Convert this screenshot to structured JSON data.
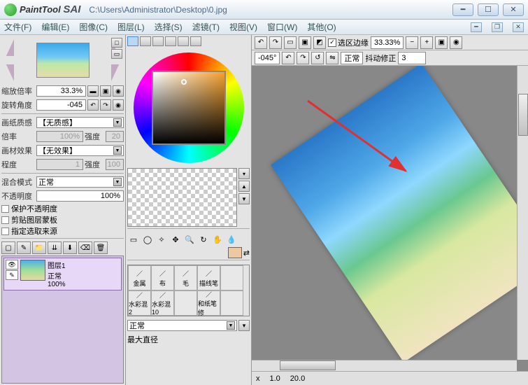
{
  "app": {
    "name": "PaintTool",
    "brand": "SAI",
    "filepath": "C:\\Users\\Administrator\\Desktop\\0.jpg"
  },
  "menu": {
    "file": "文件(F)",
    "edit": "编辑(E)",
    "image": "图像(C)",
    "layer": "图层(L)",
    "select": "选择(S)",
    "filter": "滤镜(T)",
    "view": "视图(V)",
    "window": "窗口(W)",
    "other": "其他(O)"
  },
  "nav": {
    "zoom_lbl": "缩放倍率",
    "zoom_val": "33.3%",
    "rot_lbl": "旋转角度",
    "rot_val": "-045"
  },
  "paper": {
    "lbl": "画纸质感",
    "val": "【无质感】",
    "scale_lbl": "倍率",
    "scale_val": "100%",
    "intensity_lbl": "强度",
    "intensity_val": "20"
  },
  "mat": {
    "lbl": "画材效果",
    "val": "【无效果】",
    "deg_lbl": "程度",
    "deg_val": "1",
    "int_lbl": "强度",
    "int_val": "100"
  },
  "blend": {
    "lbl": "混合模式",
    "val": "正常"
  },
  "opacity": {
    "lbl": "不透明度",
    "val": "100%"
  },
  "checks": {
    "c1": "保护不透明度",
    "c2": "剪贴图层蒙板",
    "c3": "指定选取来源"
  },
  "layer": {
    "name": "图层1",
    "mode": "正常",
    "opacity": "100%"
  },
  "brushes": {
    "r1": [
      "金属",
      "布",
      "毛",
      "描线笔",
      ""
    ],
    "r2": [
      "水彩混2",
      "水彩混10",
      "",
      "和纸笔修",
      ""
    ]
  },
  "brushmode": "正常",
  "brushsize_lbl": "最大直径",
  "toolbar": {
    "selection_edge": "选区边缘",
    "zoom": "33.33%",
    "angle": "-045°",
    "mode": "正常",
    "stabilizer_lbl": "抖动修正",
    "stabilizer_val": "3"
  },
  "status": {
    "x_lbl": "x",
    "x_val": "1.0",
    "size_lbl": "",
    "size_val": "20.0"
  }
}
